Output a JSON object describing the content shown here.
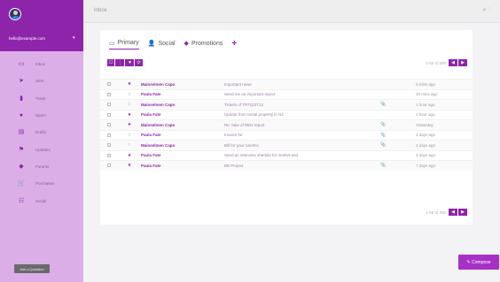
{
  "user": {
    "email": "hello@example.com"
  },
  "nav": [
    {
      "label": "Inbox",
      "icon": "inbox-icon",
      "glyph": "▭"
    },
    {
      "label": "Sent",
      "icon": "sent-icon",
      "glyph": "➤"
    },
    {
      "label": "Trash",
      "icon": "trash-icon",
      "glyph": "▮"
    },
    {
      "label": "Spam",
      "icon": "spam-icon",
      "glyph": "●"
    },
    {
      "label": "Drafts",
      "icon": "drafts-icon",
      "glyph": "▤"
    },
    {
      "label": "Updates",
      "icon": "flag-icon",
      "glyph": "⚑"
    },
    {
      "label": "Forums",
      "icon": "tag-icon",
      "glyph": "◆"
    },
    {
      "label": "Purchases",
      "icon": "cart-icon",
      "glyph": "🛒"
    },
    {
      "label": "Social",
      "icon": "group-icon",
      "glyph": "☷"
    }
  ],
  "help_label": "Ask a Question",
  "topbar": {
    "title": "Inbox"
  },
  "tabs": [
    {
      "label": "Primary",
      "icon": "inbox-tab-icon",
      "glyph": "▭"
    },
    {
      "label": "Social",
      "icon": "person-icon",
      "glyph": "👤"
    },
    {
      "label": "Promotions",
      "icon": "tag-icon",
      "glyph": "◆"
    }
  ],
  "toolbar": {
    "select": "☐",
    "more": "⋮",
    "labels": "▼",
    "refresh": "⟳"
  },
  "pager": {
    "text": "1-50 of 200",
    "prev": "◀",
    "next": "▶"
  },
  "emails": [
    {
      "sender": "Mainselmen Capo",
      "subject": "Important news",
      "attach": "",
      "time": "5 mins ago",
      "starred": true
    },
    {
      "sender": "Paula Fate",
      "subject": "Send me an important report",
      "attach": "",
      "time": "20 mins ago",
      "starred": false
    },
    {
      "sender": "Mainselmen Capo",
      "subject": "Tickets of TRTQI3T13",
      "attach": "📎",
      "time": "1 hour ago",
      "starred": false
    },
    {
      "sender": "Paula Fate",
      "subject": "Update from rental property in NJ",
      "attach": "",
      "time": "1 hour ago",
      "starred": true
    },
    {
      "sender": "Mainselmen Capo",
      "subject": "Re: fake of REN report",
      "attach": "📎",
      "time": "Yesterday",
      "starred": true
    },
    {
      "sender": "Paula Fate",
      "subject": "Invoice for",
      "attach": "📎",
      "time": "2 days ago",
      "starred": false
    },
    {
      "sender": "Mainselmen Capo",
      "subject": "Bill for your Uselms",
      "attach": "📎",
      "time": "2 days ago",
      "starred": false
    },
    {
      "sender": "Paula Fate",
      "subject": "Send an interview shedule for market and",
      "attach": "",
      "time": "3 days ago",
      "starred": true
    },
    {
      "sender": "Paula Fate",
      "subject": "BE Project",
      "attach": "📎",
      "time": "7 days ago",
      "starred": true
    }
  ],
  "compose_label": "✎ Compose"
}
